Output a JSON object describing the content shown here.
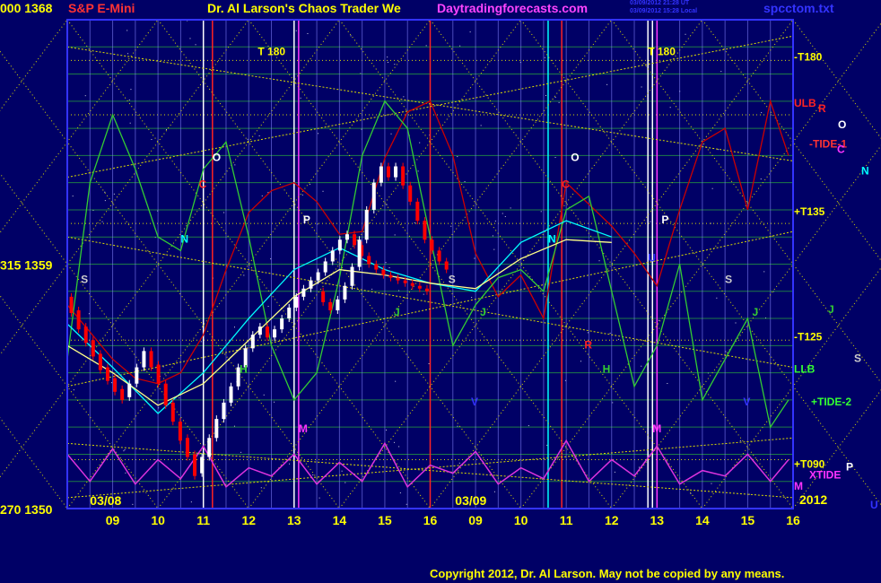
{
  "header": {
    "left_price": "000  1368",
    "instrument": "S&P E-Mini",
    "title": "Dr. Al Larson's Chaos Trader We",
    "website": "Daytradingforecasts.com",
    "time_ut": "03/09/2012 21:28 UT",
    "time_local": "03/09/2012 15:28 Local",
    "file": "spcctom.txt"
  },
  "copyright": "Copyright 2012, Dr. Al Larson.  May not be copied by any means.",
  "year_label": "2012",
  "colors": {
    "background": "#000066",
    "plot_border": "#3333ff",
    "up_bar": "#ffffff",
    "down_bar": "#ff0000",
    "grid_h": "#33cc33",
    "grid_v": "#8888ff",
    "diagonal": "#dddd00",
    "tide1": "#cc0000",
    "tide2": "#33cc33",
    "xtide": "#dd33dd",
    "ma": "#00ffff"
  },
  "chart_data": {
    "type": "line",
    "subtype": "price bars with forecast tides and cycle labels",
    "ylim": [
      1350,
      1368
    ],
    "y_ticks": [
      {
        "value": 1368,
        "label": "000  1368"
      },
      {
        "value": 1359,
        "label": "315  1359"
      },
      {
        "value": 1350,
        "label": "270  1350"
      }
    ],
    "x_hours": [
      9,
      10,
      11,
      12,
      13,
      14,
      15,
      16
    ],
    "date_labels": [
      "03/08",
      "03/09"
    ],
    "day1_bars": [
      [
        1357.8,
        1357.2
      ],
      [
        1357.3,
        1356.6
      ],
      [
        1356.7,
        1356.1
      ],
      [
        1356.2,
        1355.6
      ],
      [
        1355.7,
        1355.1
      ],
      [
        1355.2,
        1354.7
      ],
      [
        1354.8,
        1354.3
      ],
      [
        1354.4,
        1354.0
      ],
      [
        1354.1,
        1354.6
      ],
      [
        1354.6,
        1355.2
      ],
      [
        1355.2,
        1355.8
      ],
      [
        1355.8,
        1355.2
      ],
      [
        1355.3,
        1354.6
      ],
      [
        1354.6,
        1353.8
      ],
      [
        1353.9,
        1353.2
      ],
      [
        1353.2,
        1352.5
      ],
      [
        1352.6,
        1351.9
      ],
      [
        1352.0,
        1351.2
      ],
      [
        1351.3,
        1351.9
      ],
      [
        1351.9,
        1352.6
      ],
      [
        1352.6,
        1353.3
      ],
      [
        1353.3,
        1353.9
      ],
      [
        1353.9,
        1354.5
      ],
      [
        1354.5,
        1355.2
      ],
      [
        1355.2,
        1355.9
      ],
      [
        1355.9,
        1356.4
      ],
      [
        1356.4,
        1356.7
      ],
      [
        1356.7,
        1356.3
      ],
      [
        1356.3,
        1356.6
      ],
      [
        1356.6,
        1357.0
      ],
      [
        1357.0,
        1357.4
      ],
      [
        1357.4,
        1357.8
      ],
      [
        1357.8,
        1358.1
      ],
      [
        1358.1,
        1358.4
      ],
      [
        1358.4,
        1358.7
      ],
      [
        1358.7,
        1359.1
      ],
      [
        1359.1,
        1359.5
      ],
      [
        1359.5,
        1359.9
      ],
      [
        1359.9,
        1360.1
      ],
      [
        1360.1,
        1359.7
      ],
      [
        1359.7,
        1359.3
      ],
      [
        1359.3,
        1359.0
      ],
      [
        1359.0,
        1358.8
      ],
      [
        1358.8,
        1358.6
      ],
      [
        1358.6,
        1358.5
      ],
      [
        1358.5,
        1358.4
      ],
      [
        1358.4,
        1358.3
      ],
      [
        1358.3,
        1358.2
      ],
      [
        1358.2,
        1358.1
      ],
      [
        1358.1,
        1358.0
      ]
    ],
    "day2_bars": [
      [
        1358.0,
        1357.6
      ],
      [
        1357.6,
        1357.3
      ],
      [
        1357.3,
        1357.7
      ],
      [
        1357.7,
        1358.2
      ],
      [
        1358.2,
        1358.9
      ],
      [
        1358.9,
        1359.9
      ],
      [
        1359.9,
        1361.0
      ],
      [
        1361.0,
        1362.0
      ],
      [
        1362.0,
        1362.6
      ],
      [
        1362.6,
        1362.2
      ],
      [
        1362.2,
        1362.6
      ],
      [
        1362.6,
        1361.9
      ],
      [
        1361.9,
        1361.3
      ],
      [
        1361.3,
        1360.6
      ],
      [
        1360.6,
        1359.9
      ],
      [
        1359.9,
        1359.5
      ],
      [
        1359.5,
        1359.1
      ],
      [
        1359.1,
        1358.8
      ]
    ],
    "series": [
      {
        "key": "tide1",
        "x": [
          0,
          0.5,
          1,
          1.5,
          2,
          2.5,
          3,
          3.5,
          4,
          4.5,
          5,
          5.5,
          6,
          6.5,
          7,
          7.5,
          8,
          8.5,
          9,
          9.5,
          10,
          10.5,
          11,
          11.5,
          12,
          12.5,
          13,
          13.5,
          14,
          14.5,
          15,
          15.5,
          15.9
        ],
        "values": [
          1357.5,
          1356.5,
          1355.5,
          1354.8,
          1354.6,
          1355.0,
          1356.4,
          1358.8,
          1360.9,
          1361.7,
          1362.0,
          1361.3,
          1360.1,
          1360.2,
          1362.9,
          1364.6,
          1365.0,
          1363.0,
          1359.4,
          1357.8,
          1358.6,
          1357.0,
          1362.0,
          1361.2,
          1360.4,
          1359.4,
          1358.2,
          1361.0,
          1363.5,
          1364.0,
          1361.0,
          1365.0,
          1363.0
        ]
      },
      {
        "key": "tide2",
        "x": [
          0,
          0.5,
          1,
          1.5,
          2,
          2.5,
          3,
          3.5,
          4,
          4.5,
          5,
          5.5,
          6,
          6.5,
          7,
          7.5,
          8,
          8.5,
          9,
          9.5,
          10,
          10.5,
          11,
          11.5,
          12,
          12.5,
          13,
          13.5,
          14,
          14.5,
          15,
          15.5,
          15.9
        ],
        "values": [
          1355.5,
          1362.0,
          1364.5,
          1362.5,
          1360.0,
          1359.5,
          1362.5,
          1363.5,
          1360.0,
          1356.0,
          1354.0,
          1355.0,
          1358.5,
          1363.0,
          1365.0,
          1364.0,
          1360.0,
          1356.0,
          1357.5,
          1358.5,
          1358.8,
          1358.0,
          1361.0,
          1361.5,
          1358.0,
          1354.5,
          1356.0,
          1359.0,
          1354.0,
          1355.5,
          1357.0,
          1353.0,
          1354.0
        ]
      },
      {
        "key": "xtide",
        "x": [
          0,
          0.5,
          1,
          1.5,
          2,
          2.5,
          3,
          3.5,
          4,
          4.5,
          5,
          5.5,
          6,
          6.5,
          7,
          7.5,
          8,
          8.5,
          9,
          9.5,
          10,
          10.5,
          11,
          11.5,
          12,
          12.5,
          13,
          13.5,
          14,
          14.5,
          15,
          15.5,
          15.9
        ],
        "values": [
          1352.0,
          1351.0,
          1352.2,
          1350.9,
          1351.8,
          1351.1,
          1352.3,
          1350.8,
          1351.5,
          1351.2,
          1352.0,
          1350.9,
          1351.7,
          1351.0,
          1352.4,
          1350.8,
          1351.6,
          1351.3,
          1352.1,
          1350.9,
          1351.5,
          1351.1,
          1352.5,
          1351.0,
          1351.8,
          1351.2,
          1352.3,
          1350.9,
          1351.4,
          1351.2,
          1352.0,
          1351.0,
          1351.8
        ]
      },
      {
        "key": "ma_fast",
        "x": [
          0,
          1,
          2,
          3,
          4,
          5,
          6,
          7,
          8,
          9,
          10,
          11,
          12
        ],
        "values": [
          1356.8,
          1355.2,
          1353.5,
          1355.0,
          1357.0,
          1358.8,
          1359.6,
          1358.8,
          1358.3,
          1358.0,
          1359.8,
          1360.6,
          1360.0
        ]
      },
      {
        "key": "ma_slow",
        "x": [
          0,
          1,
          2,
          3,
          4,
          5,
          6,
          7,
          8,
          9,
          10,
          11,
          12
        ],
        "values": [
          1356.0,
          1355.0,
          1353.8,
          1354.6,
          1356.2,
          1357.8,
          1358.8,
          1358.6,
          1358.3,
          1358.1,
          1359.2,
          1359.9,
          1359.8
        ]
      }
    ],
    "right_labels": [
      {
        "text": "-T180",
        "value": 1366.5,
        "color": "#ffff00"
      },
      {
        "text": "ULB",
        "value": 1364.8,
        "color": "#ff2222"
      },
      {
        "text": "R",
        "value": 1364.6,
        "color": "#ff2222"
      },
      {
        "text": "O",
        "value": 1364.0,
        "color": "#ffffff"
      },
      {
        "text": "-TIDE-1",
        "value": 1363.3,
        "color": "#ff3333"
      },
      {
        "text": "C",
        "value": 1363.1,
        "color": "#ff33ff"
      },
      {
        "text": "N",
        "value": 1362.3,
        "color": "#00ffff"
      },
      {
        "text": "+T135",
        "value": 1360.8,
        "color": "#ffff00"
      },
      {
        "text": "J",
        "value": 1357.2,
        "color": "#33cc33"
      },
      {
        "text": "-T125",
        "value": 1356.2,
        "color": "#ffff00"
      },
      {
        "text": "S",
        "value": 1355.4,
        "color": "#cccccc"
      },
      {
        "text": "LLB",
        "value": 1355.0,
        "color": "#33ff33"
      },
      {
        "text": "+TIDE-2",
        "value": 1353.8,
        "color": "#33ff33"
      },
      {
        "text": "+T090",
        "value": 1351.5,
        "color": "#ffff00"
      },
      {
        "text": "P",
        "value": 1351.4,
        "color": "#ffffff"
      },
      {
        "text": "XTIDE",
        "value": 1351.1,
        "color": "#ff33ff"
      },
      {
        "text": "M",
        "value": 1350.7,
        "color": "#ff33ff"
      },
      {
        "text": "U",
        "value": 1350.0,
        "color": "#3333ff"
      }
    ],
    "cycle_labels": [
      {
        "text": "S",
        "x": 0.3,
        "value": 1358.3,
        "color": "#cccccc"
      },
      {
        "text": "T   180",
        "x": 4.2,
        "value": 1366.7,
        "color": "#ffff00"
      },
      {
        "text": "O",
        "x": 3.2,
        "value": 1362.8,
        "color": "#ffffff"
      },
      {
        "text": "C",
        "x": 2.9,
        "value": 1361.8,
        "color": "#ff2222"
      },
      {
        "text": "N",
        "x": 2.5,
        "value": 1359.8,
        "color": "#00ffff"
      },
      {
        "text": "P",
        "x": 5.2,
        "value": 1360.5,
        "color": "#ffffff"
      },
      {
        "text": "H",
        "x": 3.8,
        "value": 1355.0,
        "color": "#33cc33"
      },
      {
        "text": "M",
        "x": 5.1,
        "value": 1352.8,
        "color": "#ff33ff"
      },
      {
        "text": "J",
        "x": 7.2,
        "value": 1357.1,
        "color": "#33cc33"
      },
      {
        "text": "S",
        "x": 8.4,
        "value": 1358.3,
        "color": "#cccccc"
      },
      {
        "text": "J",
        "x": 9.1,
        "value": 1357.1,
        "color": "#33cc33"
      },
      {
        "text": "V",
        "x": 8.9,
        "value": 1353.8,
        "color": "#3333ff"
      },
      {
        "text": "T   180",
        "x": 12.8,
        "value": 1366.7,
        "color": "#ffff00"
      },
      {
        "text": "O",
        "x": 11.1,
        "value": 1362.8,
        "color": "#ffffff"
      },
      {
        "text": "C",
        "x": 10.9,
        "value": 1361.8,
        "color": "#ff2222"
      },
      {
        "text": "N",
        "x": 10.6,
        "value": 1359.8,
        "color": "#00ffff"
      },
      {
        "text": "P",
        "x": 13.1,
        "value": 1360.5,
        "color": "#ffffff"
      },
      {
        "text": "R",
        "x": 11.4,
        "value": 1355.9,
        "color": "#ff2222"
      },
      {
        "text": "H",
        "x": 11.8,
        "value": 1355.0,
        "color": "#33cc33"
      },
      {
        "text": "U",
        "x": 12.8,
        "value": 1359.1,
        "color": "#3333ff"
      },
      {
        "text": "M",
        "x": 12.9,
        "value": 1352.8,
        "color": "#ff33ff"
      },
      {
        "text": "S",
        "x": 14.5,
        "value": 1358.3,
        "color": "#cccccc"
      },
      {
        "text": "J",
        "x": 15.1,
        "value": 1357.1,
        "color": "#33cc33"
      },
      {
        "text": "V",
        "x": 14.9,
        "value": 1353.8,
        "color": "#3333ff"
      }
    ]
  }
}
